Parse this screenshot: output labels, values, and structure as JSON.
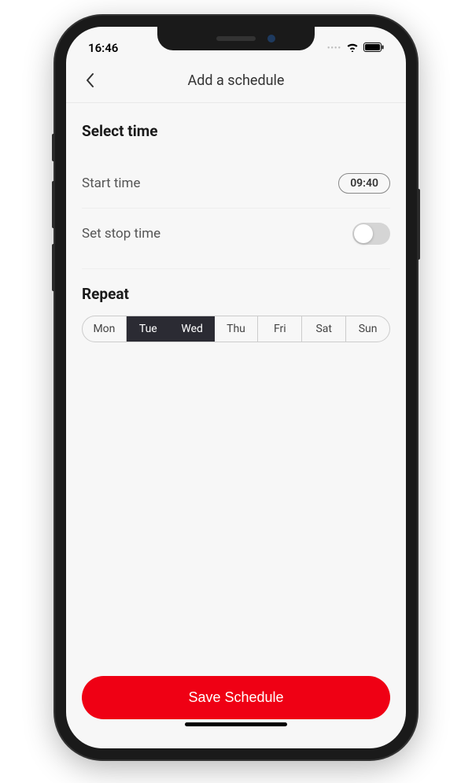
{
  "status": {
    "time": "16:46"
  },
  "header": {
    "title": "Add a schedule"
  },
  "select_time": {
    "title": "Select time",
    "start_label": "Start time",
    "start_value": "09:40",
    "stop_label": "Set stop time",
    "stop_enabled": false
  },
  "repeat": {
    "title": "Repeat",
    "days": [
      {
        "label": "Mon",
        "selected": false
      },
      {
        "label": "Tue",
        "selected": true
      },
      {
        "label": "Wed",
        "selected": true
      },
      {
        "label": "Thu",
        "selected": false
      },
      {
        "label": "Fri",
        "selected": false
      },
      {
        "label": "Sat",
        "selected": false
      },
      {
        "label": "Sun",
        "selected": false
      }
    ]
  },
  "footer": {
    "save_label": "Save Schedule"
  },
  "colors": {
    "accent": "#ef0014",
    "day_selected_bg": "#2b2b33"
  }
}
